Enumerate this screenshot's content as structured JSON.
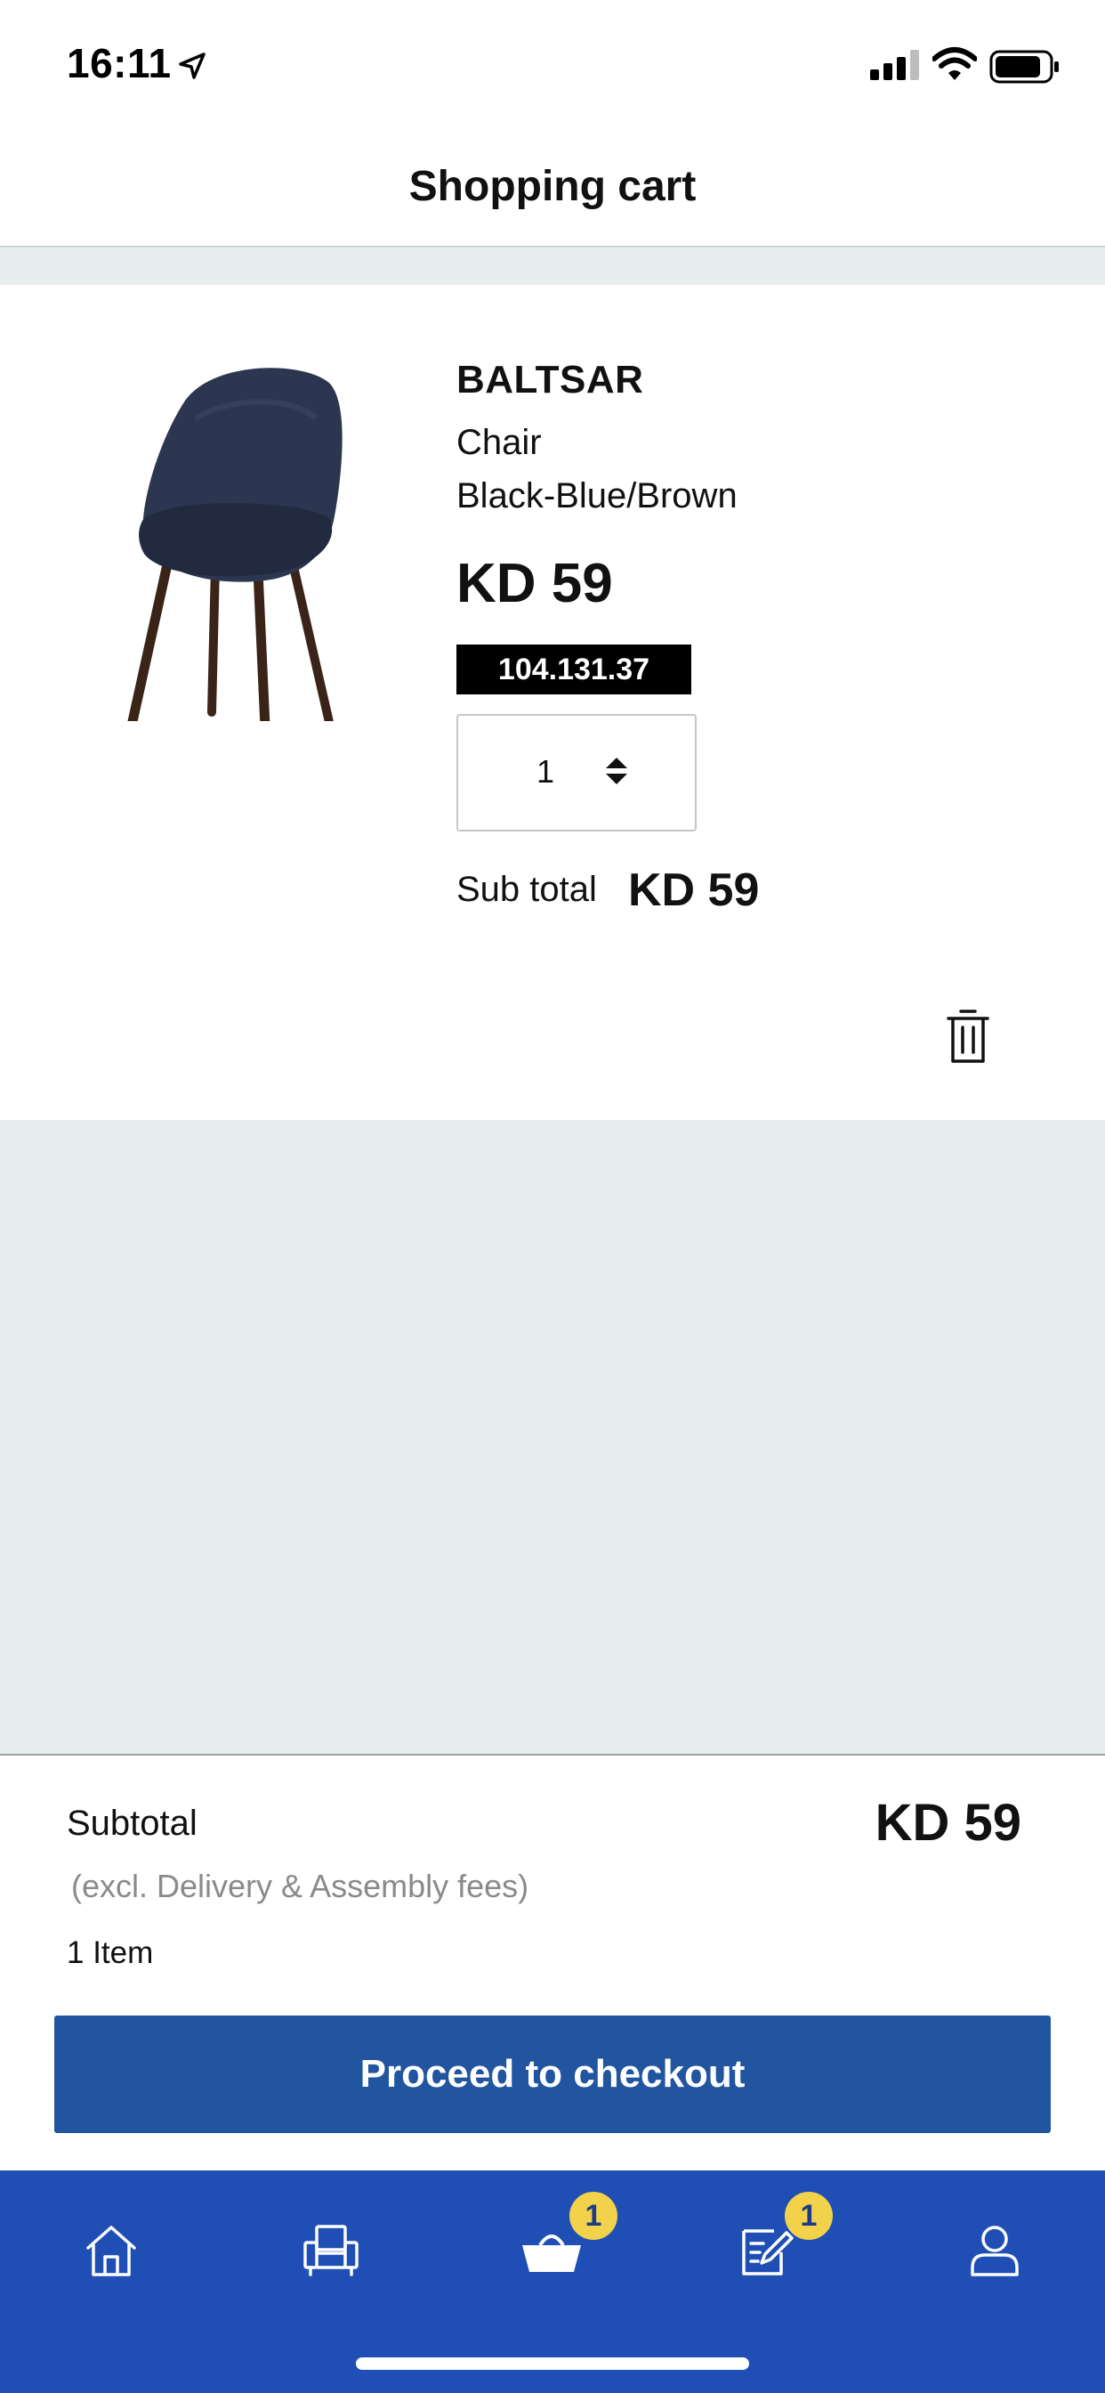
{
  "status_bar": {
    "time": "16:11",
    "icons": [
      "location-arrow-icon",
      "signal-icon",
      "wifi-icon",
      "battery-icon"
    ]
  },
  "header": {
    "title": "Shopping cart"
  },
  "cart_item": {
    "name": "BALTSAR",
    "type": "Chair",
    "color": "Black-Blue/Brown",
    "price": "KD 59",
    "article_number": "104.131.37",
    "quantity": "1",
    "subtotal_label": "Sub total",
    "subtotal_value": "KD 59",
    "image": "chair-image",
    "delete_icon": "trash-icon"
  },
  "summary": {
    "label": "Subtotal",
    "value": "KD 59",
    "note": "(excl. Delivery & Assembly fees)",
    "item_count": "1 Item",
    "checkout_label": "Proceed to checkout"
  },
  "tab_bar": {
    "tabs": [
      {
        "icon": "home-icon"
      },
      {
        "icon": "products-armchair-icon"
      },
      {
        "icon": "cart-basket-icon",
        "badge": "1"
      },
      {
        "icon": "shopping-list-icon",
        "badge": "1"
      },
      {
        "icon": "profile-icon"
      }
    ]
  },
  "colors": {
    "tab_bar_bg": "#1f4fb5",
    "checkout_bg": "#22559f",
    "badge_bg": "#f1d24a",
    "page_bg": "#e8eded"
  }
}
